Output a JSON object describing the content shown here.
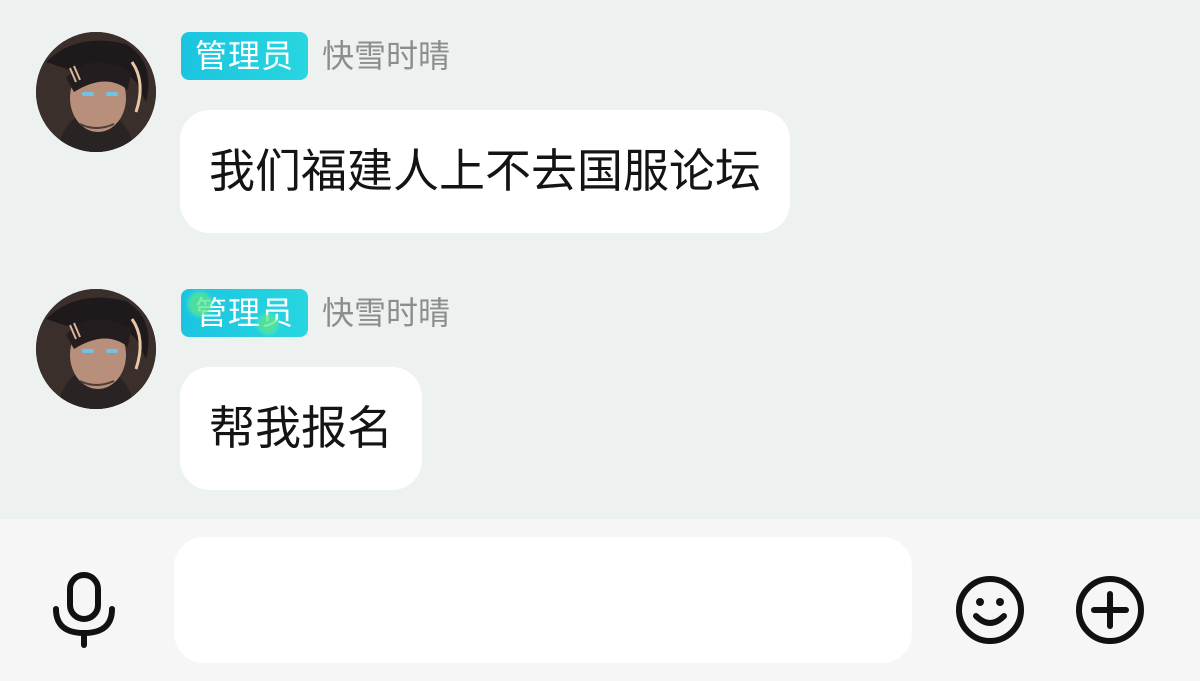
{
  "messages": [
    {
      "badge": "管理员",
      "sender": "快雪时晴",
      "text": "我们福建人上不去国服论坛"
    },
    {
      "badge": "管理员",
      "sender": "快雪时晴",
      "text": "帮我报名"
    }
  ],
  "composer": {
    "input_value": "",
    "mic_icon": "microphone-icon",
    "emoji_icon": "smiley-icon",
    "plus_icon": "plus-circle-icon"
  },
  "colors": {
    "background": "#edf1ef",
    "badge": "#1cc4e0",
    "bubble": "#ffffff",
    "composer_bar": "#f6f6f6",
    "nickname": "#8a8e8d"
  }
}
